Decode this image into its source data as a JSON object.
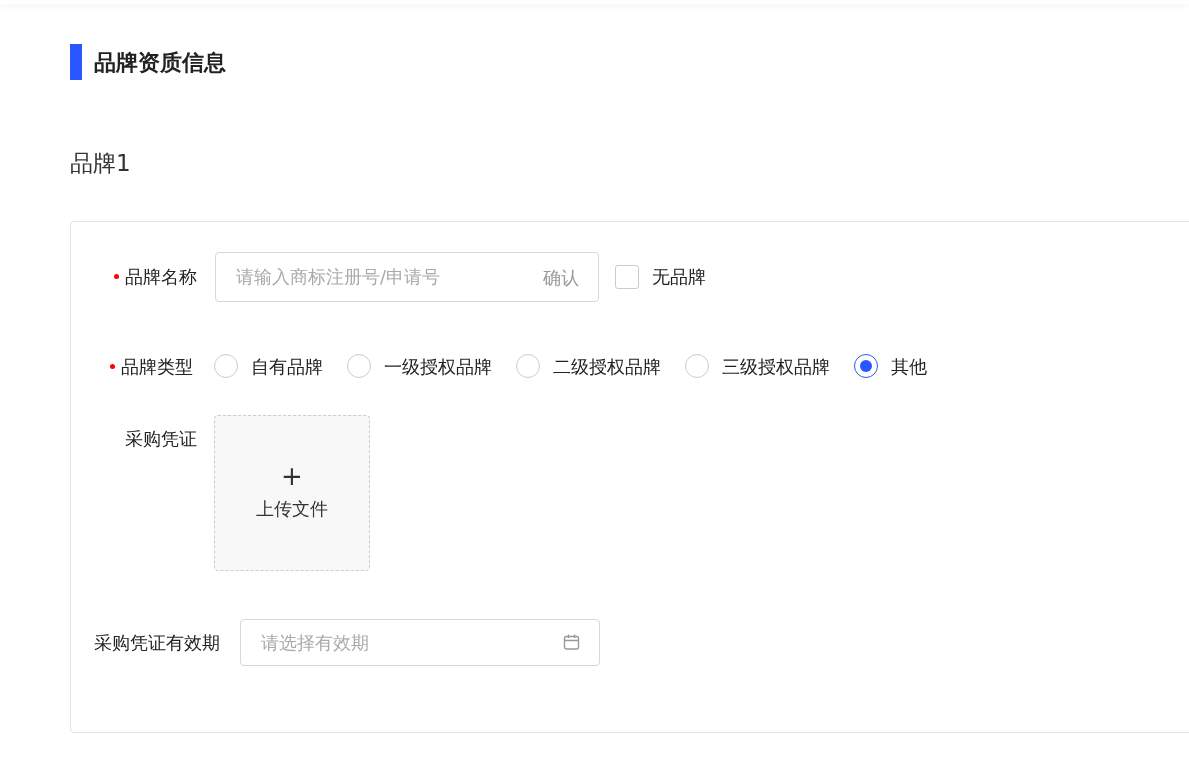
{
  "section_title": "品牌资质信息",
  "brand_title": "品牌1",
  "brand_name": {
    "label": "品牌名称",
    "required": true,
    "placeholder": "请输入商标注册号/申请号",
    "confirm": "确认",
    "no_brand": {
      "label": "无品牌",
      "checked": false
    }
  },
  "brand_type": {
    "label": "品牌类型",
    "required": true,
    "options": [
      {
        "label": "自有品牌",
        "selected": false
      },
      {
        "label": "一级授权品牌",
        "selected": false
      },
      {
        "label": "二级授权品牌",
        "selected": false
      },
      {
        "label": "三级授权品牌",
        "selected": false
      },
      {
        "label": "其他",
        "selected": true
      }
    ]
  },
  "voucher": {
    "label": "采购凭证",
    "required": false,
    "upload_icon": "+",
    "upload_label": "上传文件"
  },
  "voucher_expiry": {
    "label": "采购凭证有效期",
    "required": false,
    "placeholder": "请选择有效期"
  }
}
